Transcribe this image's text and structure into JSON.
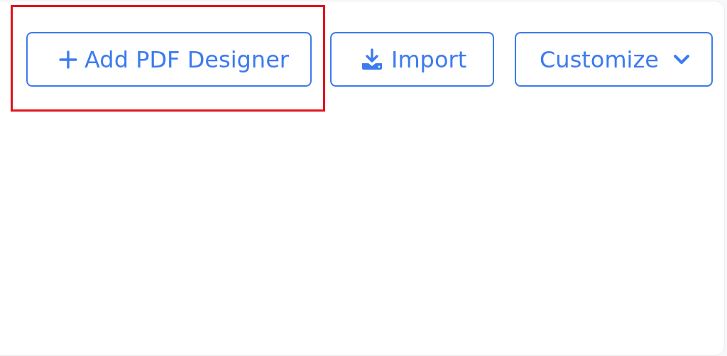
{
  "toolbar": {
    "buttons": [
      {
        "kind": "add",
        "label": "Add PDF Designer",
        "highlighted": true
      },
      {
        "kind": "import",
        "label": "Import",
        "highlighted": false
      },
      {
        "kind": "dropdown",
        "label": "Customize",
        "highlighted": false
      }
    ]
  }
}
